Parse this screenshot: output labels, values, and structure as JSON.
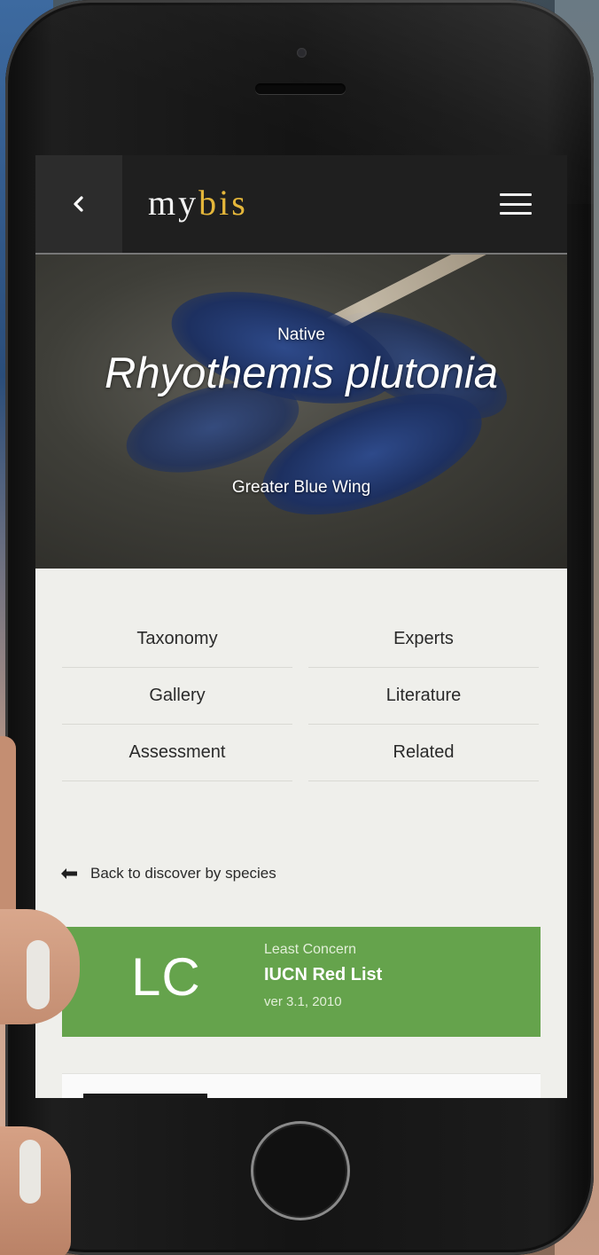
{
  "app": {
    "logo_prefix": "my",
    "logo_accent": "bis",
    "accent_color": "#e4b63a"
  },
  "topbar": {
    "back_icon": "chevron-left-icon",
    "menu_icon": "hamburger-menu-icon"
  },
  "species": {
    "status": "Native",
    "scientific_name": "Rhyothemis plutonia",
    "common_name": "Greater Blue Wing"
  },
  "nav": {
    "items": [
      {
        "label": "Taxonomy"
      },
      {
        "label": "Experts"
      },
      {
        "label": "Gallery"
      },
      {
        "label": "Literature"
      },
      {
        "label": "Assessment"
      },
      {
        "label": "Related"
      }
    ]
  },
  "back_link": {
    "label": "Back to discover by species",
    "icon": "arrow-left-icon"
  },
  "conservation": {
    "code": "LC",
    "category": "Least Concern",
    "list_name": "IUCN Red List",
    "version": "ver 3.1, 2010",
    "color": "#65a34c"
  }
}
